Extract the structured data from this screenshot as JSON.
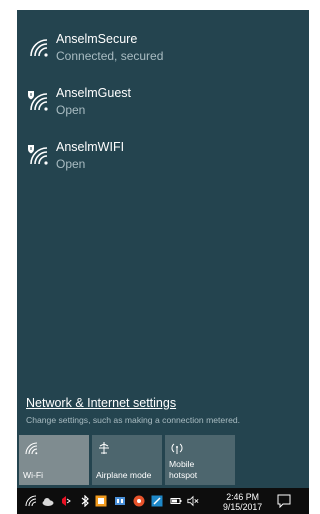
{
  "networks": [
    {
      "name": "AnselmSecure",
      "status": "Connected, secured",
      "icon": "wifi-icon"
    },
    {
      "name": "AnselmGuest",
      "status": "Open",
      "icon": "wifi-shield-icon"
    },
    {
      "name": "AnselmWIFI",
      "status": "Open",
      "icon": "wifi-shield-icon"
    }
  ],
  "settings": {
    "link": "Network & Internet settings",
    "description": "Change settings, such as making a connection metered."
  },
  "quick_actions": [
    {
      "label": "Wi-Fi",
      "icon": "wifi-icon",
      "active": true
    },
    {
      "label": "Airplane mode",
      "icon": "airplane-icon",
      "active": false
    },
    {
      "label": "Mobile\nhotspot",
      "icon": "hotspot-icon",
      "active": false
    }
  ],
  "taskbar": {
    "time": "2:46 PM",
    "date": "9/15/2017",
    "icons": [
      "wifi-icon",
      "onedrive-icon",
      "antivirus-icon",
      "bluetooth-icon",
      "app-orange-icon",
      "app-blue-icon",
      "app-red-icon",
      "app-cyan-icon",
      "battery-icon",
      "volume-muted-icon",
      "notification-icon"
    ]
  },
  "colors": {
    "flyout_bg": "#24444f",
    "tile_active": "#7f8c90",
    "tile_inactive": "#4d666e",
    "taskbar_bg": "#0d0d0d"
  }
}
